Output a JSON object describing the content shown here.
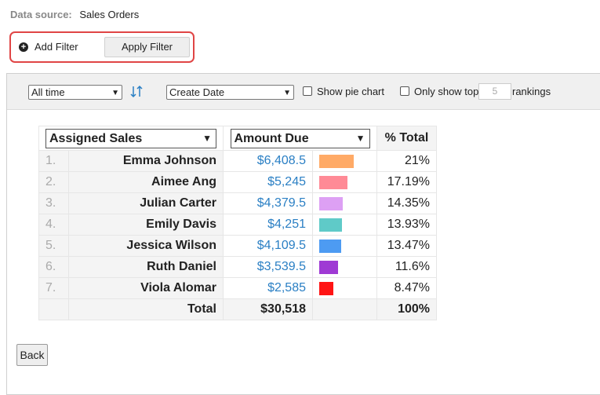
{
  "data_source": {
    "label": "Data source:",
    "value": "Sales Orders"
  },
  "filters": {
    "add_label": "Add Filter",
    "apply_label": "Apply Filter"
  },
  "toolbar": {
    "time_range": "All time",
    "date_field": "Create Date",
    "show_pie_label": "Show pie chart",
    "show_pie_checked": false,
    "top_prefix": "Only show top",
    "top_value": "5",
    "top_suffix": "rankings",
    "top_checked": false
  },
  "table": {
    "group_by": "Assigned Sales",
    "measure": "Amount Due",
    "pct_header": "% Total",
    "rows": [
      {
        "rank": "1.",
        "name": "Emma Johnson",
        "amount": "$6,408.5",
        "pct": "21%",
        "pct_value": 21,
        "color": "#ffaa66"
      },
      {
        "rank": "2.",
        "name": "Aimee Ang",
        "amount": "$5,245",
        "pct": "17.19%",
        "pct_value": 17.19,
        "color": "#ff8a96"
      },
      {
        "rank": "3.",
        "name": "Julian Carter",
        "amount": "$4,379.5",
        "pct": "14.35%",
        "pct_value": 14.35,
        "color": "#dda0f4"
      },
      {
        "rank": "4.",
        "name": "Emily Davis",
        "amount": "$4,251",
        "pct": "13.93%",
        "pct_value": 13.93,
        "color": "#5fcac8"
      },
      {
        "rank": "5.",
        "name": "Jessica Wilson",
        "amount": "$4,109.5",
        "pct": "13.47%",
        "pct_value": 13.47,
        "color": "#4d9bf2"
      },
      {
        "rank": "6.",
        "name": "Ruth Daniel",
        "amount": "$3,539.5",
        "pct": "11.6%",
        "pct_value": 11.6,
        "color": "#9f3ad4"
      },
      {
        "rank": "7.",
        "name": "Viola Alomar",
        "amount": "$2,585",
        "pct": "8.47%",
        "pct_value": 8.47,
        "color": "#ff1414"
      }
    ],
    "total": {
      "label": "Total",
      "amount": "$30,518",
      "pct": "100%"
    }
  },
  "back_label": "Back"
}
